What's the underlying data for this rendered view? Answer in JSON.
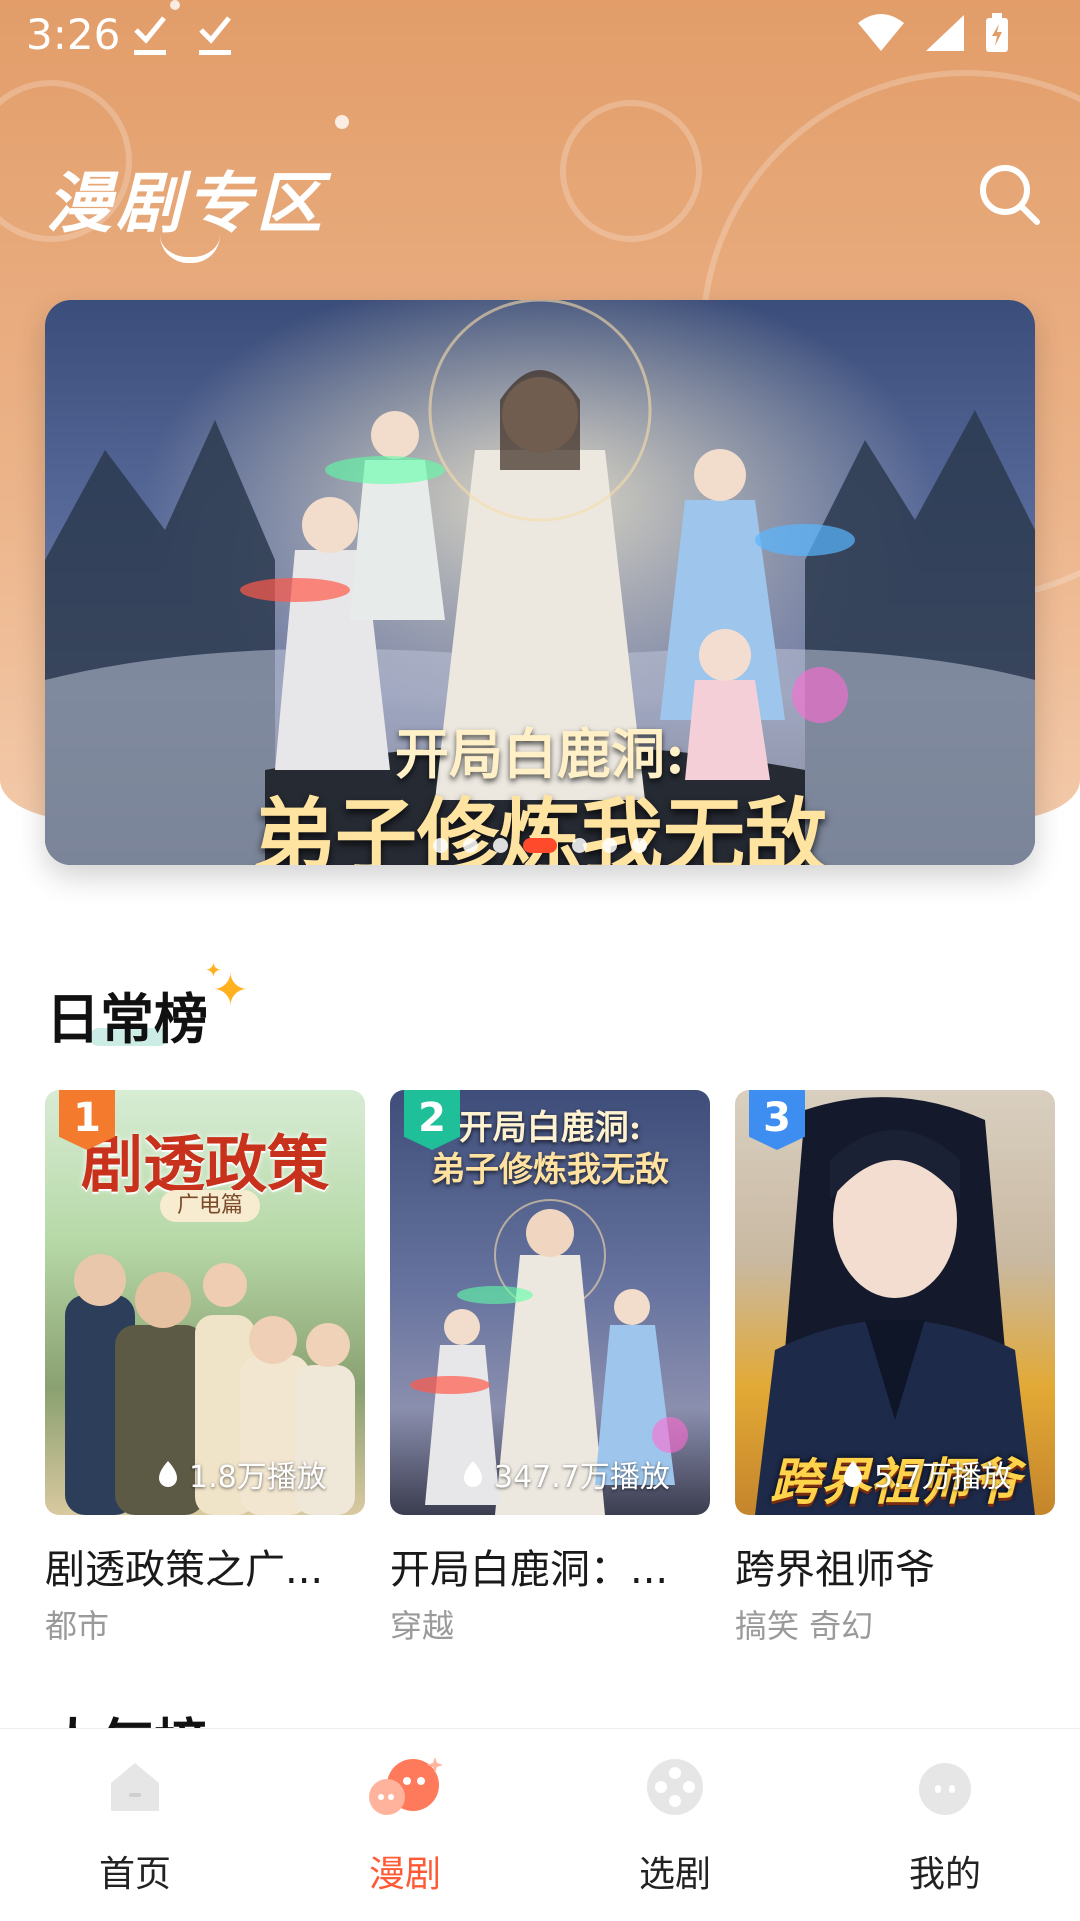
{
  "status_bar": {
    "time": "3:26"
  },
  "header": {
    "title": "漫剧专区"
  },
  "banner": {
    "title_line1": "开局白鹿洞:",
    "title_line2": "弟子修炼我无敌",
    "dot_count": 8,
    "active_index": 3
  },
  "section": {
    "title": "日常榜",
    "next_title": "人气榜"
  },
  "cards": [
    {
      "rank": "1",
      "cover_text": "剧透政策",
      "cover_sub": "广电篇",
      "plays": "1.8万播放",
      "title": "剧透政策之广...",
      "genre": "都市",
      "rank_color": "#f47a2e"
    },
    {
      "rank": "2",
      "cover_text": "开局白鹿洞:",
      "cover_sub": "弟子修炼我无敌",
      "plays": "347.7万播放",
      "title": "开局白鹿洞：...",
      "genre": "穿越",
      "rank_color": "#1fbf9a"
    },
    {
      "rank": "3",
      "cover_text": "跨界祖师爷",
      "cover_sub": "",
      "plays": "5.7万播放",
      "title": "跨界祖师爷",
      "genre": "搞笑 奇幻",
      "rank_color": "#3d8ef0"
    }
  ],
  "bottom_nav": [
    {
      "label": "首页",
      "icon": "home-icon",
      "active": false
    },
    {
      "label": "漫剧",
      "icon": "comic-drama-icon",
      "active": true
    },
    {
      "label": "选剧",
      "icon": "film-reel-icon",
      "active": false
    },
    {
      "label": "我的",
      "icon": "profile-icon",
      "active": false
    }
  ],
  "colors": {
    "accent": "#ff5a36",
    "header_bg": "#e29d69"
  }
}
